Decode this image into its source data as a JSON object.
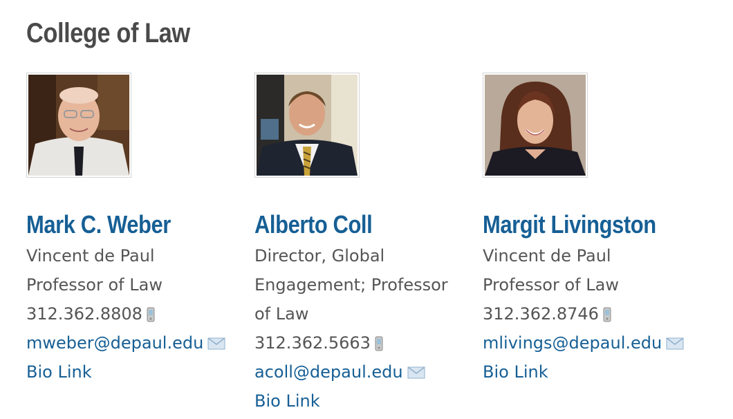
{
  "section": {
    "title": "College of Law"
  },
  "people": [
    {
      "name": "Mark C. Weber",
      "title": "Vincent de Paul Professor of Law",
      "phone": "312.362.8808",
      "email": "mweber@depaul.edu",
      "bio_label": "Bio Link",
      "photo_icon": "portrait-photo"
    },
    {
      "name": "Alberto Coll",
      "title": "Director, Global Engagement; Professor of Law",
      "phone": "312.362.5663",
      "email": "acoll@depaul.edu",
      "bio_label": "Bio Link",
      "photo_icon": "portrait-photo"
    },
    {
      "name": "Margit Livingston",
      "title": "Vincent de Paul Professor of Law",
      "phone": "312.362.8746",
      "email": "mlivings@depaul.edu",
      "bio_label": "Bio Link",
      "photo_icon": "portrait-photo"
    }
  ],
  "icons": {
    "phone": "mobile-phone-icon",
    "email": "envelope-icon"
  },
  "colors": {
    "heading": "#4a4a4a",
    "link": "#165f95",
    "text": "#555555",
    "photo_border": "#d4d4d4"
  }
}
